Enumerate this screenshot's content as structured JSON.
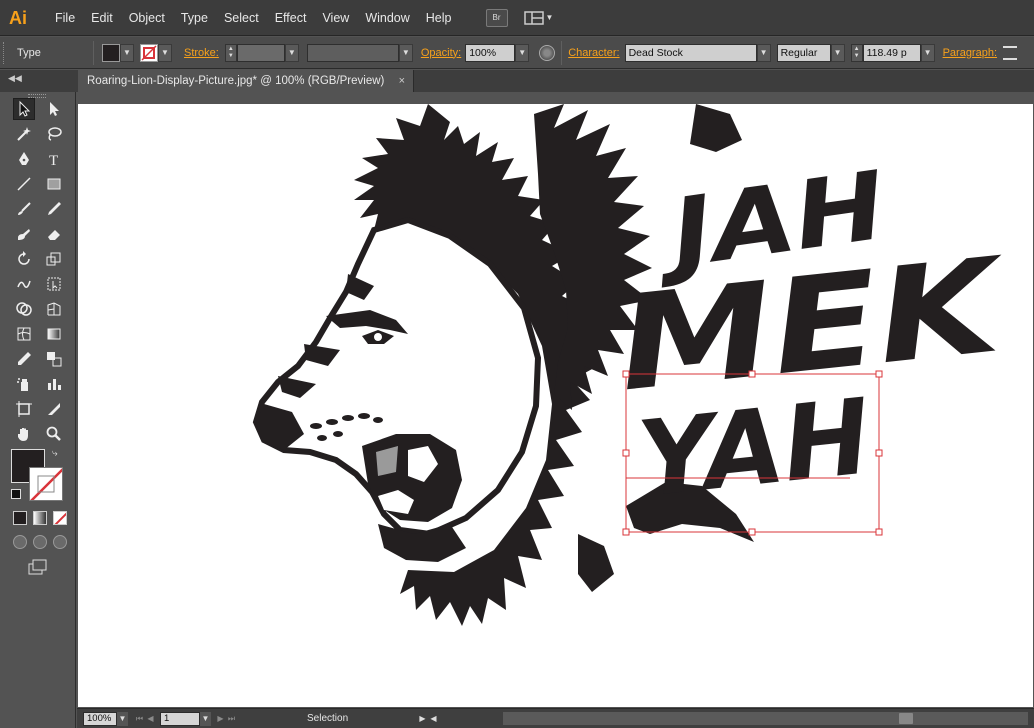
{
  "app": {
    "logo": "Ai"
  },
  "menu": [
    "File",
    "Edit",
    "Object",
    "Type",
    "Select",
    "Effect",
    "View",
    "Window",
    "Help"
  ],
  "menu_buttons": {
    "bridge": "Br"
  },
  "control": {
    "tool_label": "Type",
    "stroke_label": "Stroke:",
    "opacity_label": "Opacity:",
    "opacity_value": "100%",
    "character_label": "Character:",
    "font_name": "Dead Stock",
    "font_style": "Regular",
    "font_size": "118.49 p",
    "paragraph_label": "Paragraph:"
  },
  "document": {
    "tab_title": "Roaring-Lion-Display-Picture.jpg* @ 100% (RGB/Preview)",
    "close_glyph": "×"
  },
  "artwork": {
    "line1": "JAH",
    "line2": "MEK",
    "line3": "YAH"
  },
  "status": {
    "zoom": "100%",
    "page": "1",
    "tool": "Selection"
  },
  "colors": {
    "accent_orange": "#f7a11b",
    "selection_red": "#d9343a",
    "ink": "#231f20"
  },
  "icons": {
    "tools": [
      "selection",
      "direct-selection",
      "magic-wand",
      "lasso",
      "pen",
      "type",
      "line",
      "rectangle",
      "paintbrush",
      "pencil",
      "blob-brush",
      "eraser",
      "rotate",
      "scale",
      "warp",
      "free-transform",
      "shape-builder",
      "perspective-grid",
      "mesh",
      "gradient",
      "eyedropper",
      "blend",
      "symbol-sprayer",
      "column-graph",
      "artboard",
      "slice",
      "hand",
      "zoom"
    ]
  }
}
